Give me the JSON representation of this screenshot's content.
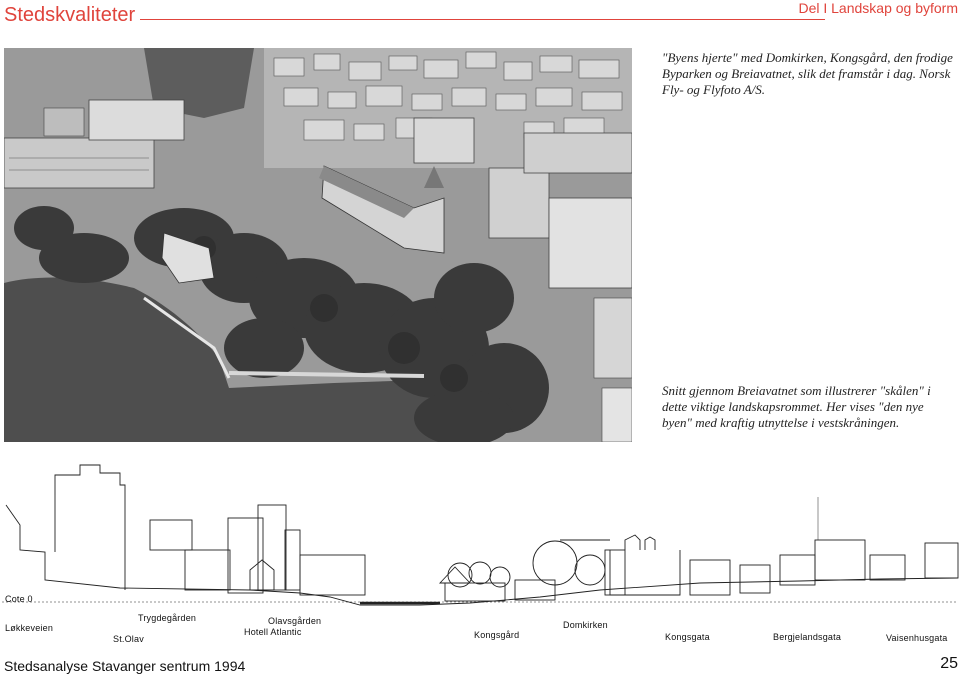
{
  "header": {
    "title": "Stedskvaliteter",
    "section": "Del I Landskap og byform"
  },
  "captions": {
    "photo": "\"Byens hjerte\" med Domkirken, Kongsgård, den frodige Byparken og Breiavatnet, slik det framstår i dag. Norsk Fly- og Flyfoto A/S.",
    "section": "Snitt gjennom Breiavatnet som illustrerer \"skålen\" i dette viktige landskapsrommet. Her vises \"den nye byen\" med kraftig utnyttelse i vestskråningen."
  },
  "section_labels": {
    "cote": "Cote 0",
    "lokkeveien": "Løkkeveien",
    "st_olav": "St.Olav",
    "trygdegarden": "Trygdegården",
    "hotell_atlantic": "Hotell Atlantic",
    "olavsgarden": "Olavsgården",
    "kongsgard": "Kongsgård",
    "domkirken": "Domkirken",
    "kongsgata": "Kongsgata",
    "bergjelandsgata": "Bergjelandsgata",
    "vaisenhusgata": "Vaisenhusgata"
  },
  "footer": {
    "publication": "Stedsanalyse Stavanger sentrum 1994",
    "page_number": "25"
  },
  "colors": {
    "accent": "#e0443c"
  }
}
